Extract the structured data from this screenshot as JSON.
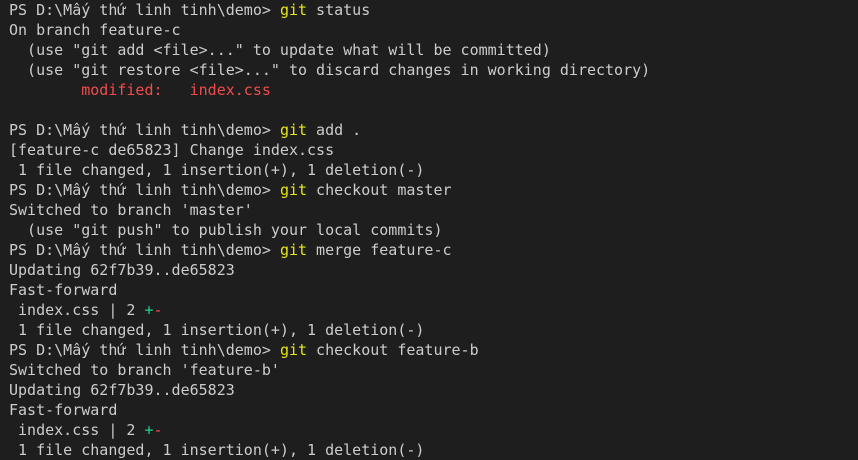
{
  "terminal": {
    "lines": [
      {
        "prompt": "PS D:\\Mấy thứ linh tinh\\demo> ",
        "cmd": "git",
        "args": " status"
      },
      {
        "text": "On branch feature-c"
      },
      {
        "text": "  (use \"git add <file>...\" to update what will be committed)"
      },
      {
        "text": "  (use \"git restore <file>...\" to discard changes in working directory)"
      },
      {
        "mod_label": "        modified:   ",
        "mod_file": "index.css"
      },
      {
        "text": ""
      },
      {
        "prompt": "PS D:\\Mấy thứ linh tinh\\demo> ",
        "cmd": "git",
        "args": " add ."
      },
      {
        "text": "[feature-c de65823] Change index.css"
      },
      {
        "text": " 1 file changed, 1 insertion(+), 1 deletion(-)"
      },
      {
        "prompt": "PS D:\\Mấy thứ linh tinh\\demo> ",
        "cmd": "git",
        "args": " checkout master"
      },
      {
        "text": "Switched to branch 'master'"
      },
      {
        "text": "  (use \"git push\" to publish your local commits)"
      },
      {
        "prompt": "PS D:\\Mấy thứ linh tinh\\demo> ",
        "cmd": "git",
        "args": " merge feature-c"
      },
      {
        "text": "Updating 62f7b39..de65823"
      },
      {
        "text": "Fast-forward"
      },
      {
        "stat": " index.css | 2 ",
        "plus": "+",
        "minus": "-"
      },
      {
        "text": " 1 file changed, 1 insertion(+), 1 deletion(-)"
      },
      {
        "prompt": "PS D:\\Mấy thứ linh tinh\\demo> ",
        "cmd": "git",
        "args": " checkout feature-b"
      },
      {
        "text": "Switched to branch 'feature-b'"
      },
      {
        "text": "Updating 62f7b39..de65823"
      },
      {
        "text": "Fast-forward"
      },
      {
        "stat": " index.css | 2 ",
        "plus": "+",
        "minus": "-"
      },
      {
        "text": " 1 file changed, 1 insertion(+), 1 deletion(-)"
      }
    ]
  },
  "colors": {
    "background": "#1e1e1e",
    "foreground": "#cccccc",
    "command": "#e5e510",
    "modified": "#f14c4c",
    "insertion": "#23d18b",
    "deletion": "#f14c4c"
  }
}
